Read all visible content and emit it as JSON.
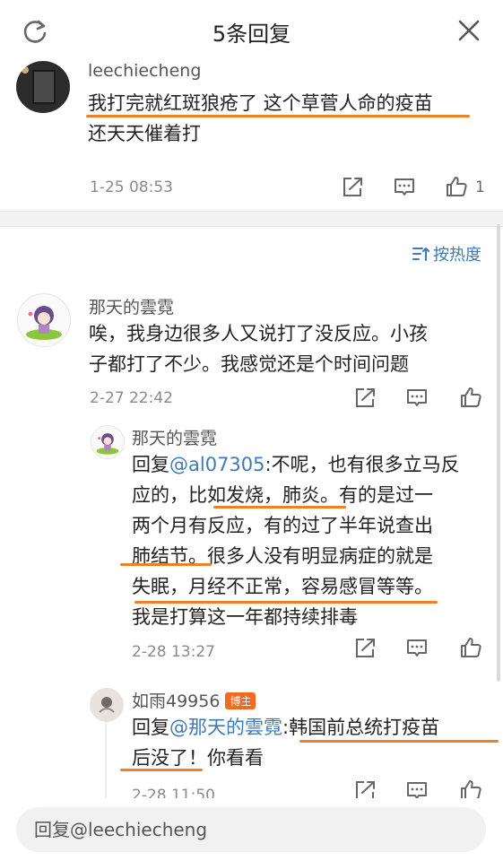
{
  "header": {
    "title": "5条回复"
  },
  "main_comment": {
    "username": "leechiecheng",
    "text_line1": "我打完就红斑狼疮了 这个草菅人命的疫苗",
    "text_line2": "还天天催着打",
    "time": "1-25 08:53",
    "like_count": "1"
  },
  "sort": {
    "label": "按热度"
  },
  "reply1": {
    "username": "那天的雲霓",
    "text_line1": "唉，我身边很多人又说打了没反应。小孩",
    "text_line2": "子都打了不少。我感觉还是个时间问题",
    "time": "2-27 22:42"
  },
  "reply2": {
    "username": "那天的雲霓",
    "reply_prefix": "回复",
    "mention": "@al07305",
    "text_line1_rest": ":不呢，也有很多立马反",
    "text_line2": "应的，比如发烧，肺炎。有的是过一",
    "text_line3": "两个月有反应，有的过了半年说查出",
    "text_line4": "肺结节。很多人没有明显病症的就是",
    "text_line5": "失眠，月经不正常，容易感冒等等。",
    "text_line6": "我是打算这一年都持续排毒",
    "time": "2-28 13:27"
  },
  "reply3": {
    "username": "如雨49956",
    "badge": "博主",
    "reply_prefix": "回复",
    "mention": "@那天的雲霓",
    "text_line1_rest": ":韩国前总统打疫苗",
    "text_line2": "后没了！你看看",
    "time": "2-28 11:50"
  },
  "reply_bar": {
    "placeholder": "回复@leechiecheng"
  },
  "colors": {
    "accent_blue": "#3d7ab8",
    "underline_orange": "#f07f26",
    "badge_orange": "#f26a21"
  }
}
